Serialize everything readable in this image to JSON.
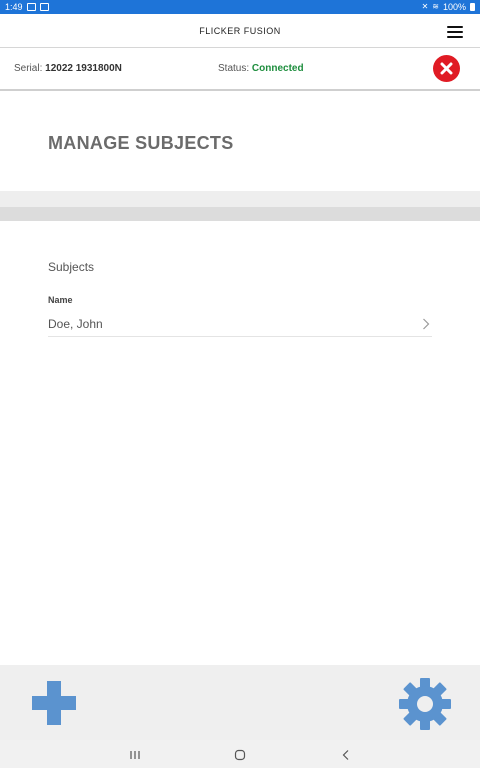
{
  "status_bar": {
    "time": "1:49",
    "battery": "100%",
    "icons": [
      "notification-icon",
      "gallery-icon",
      "mute-icon",
      "wifi-icon",
      "battery-icon"
    ]
  },
  "app_bar": {
    "title": "FLICKER FUSION",
    "menu_icon": "hamburger-menu-icon"
  },
  "device": {
    "serial_label": "Serial:",
    "serial_value": "12022 1931800N",
    "status_label": "Status:",
    "status_value": "Connected",
    "status_color": "#1e8e3e",
    "disconnect_icon": "close-circle-icon",
    "disconnect_color": "#e01b24"
  },
  "page": {
    "title": "MANAGE SUBJECTS"
  },
  "subjects": {
    "section_label": "Subjects",
    "column_header": "Name",
    "rows": [
      {
        "name": "Doe, John"
      }
    ]
  },
  "toolbar": {
    "add_icon": "plus-icon",
    "settings_icon": "gear-icon",
    "accent_color": "#5b93cf"
  },
  "system_nav": {
    "icons": [
      "recents-icon",
      "home-icon",
      "back-icon"
    ]
  }
}
